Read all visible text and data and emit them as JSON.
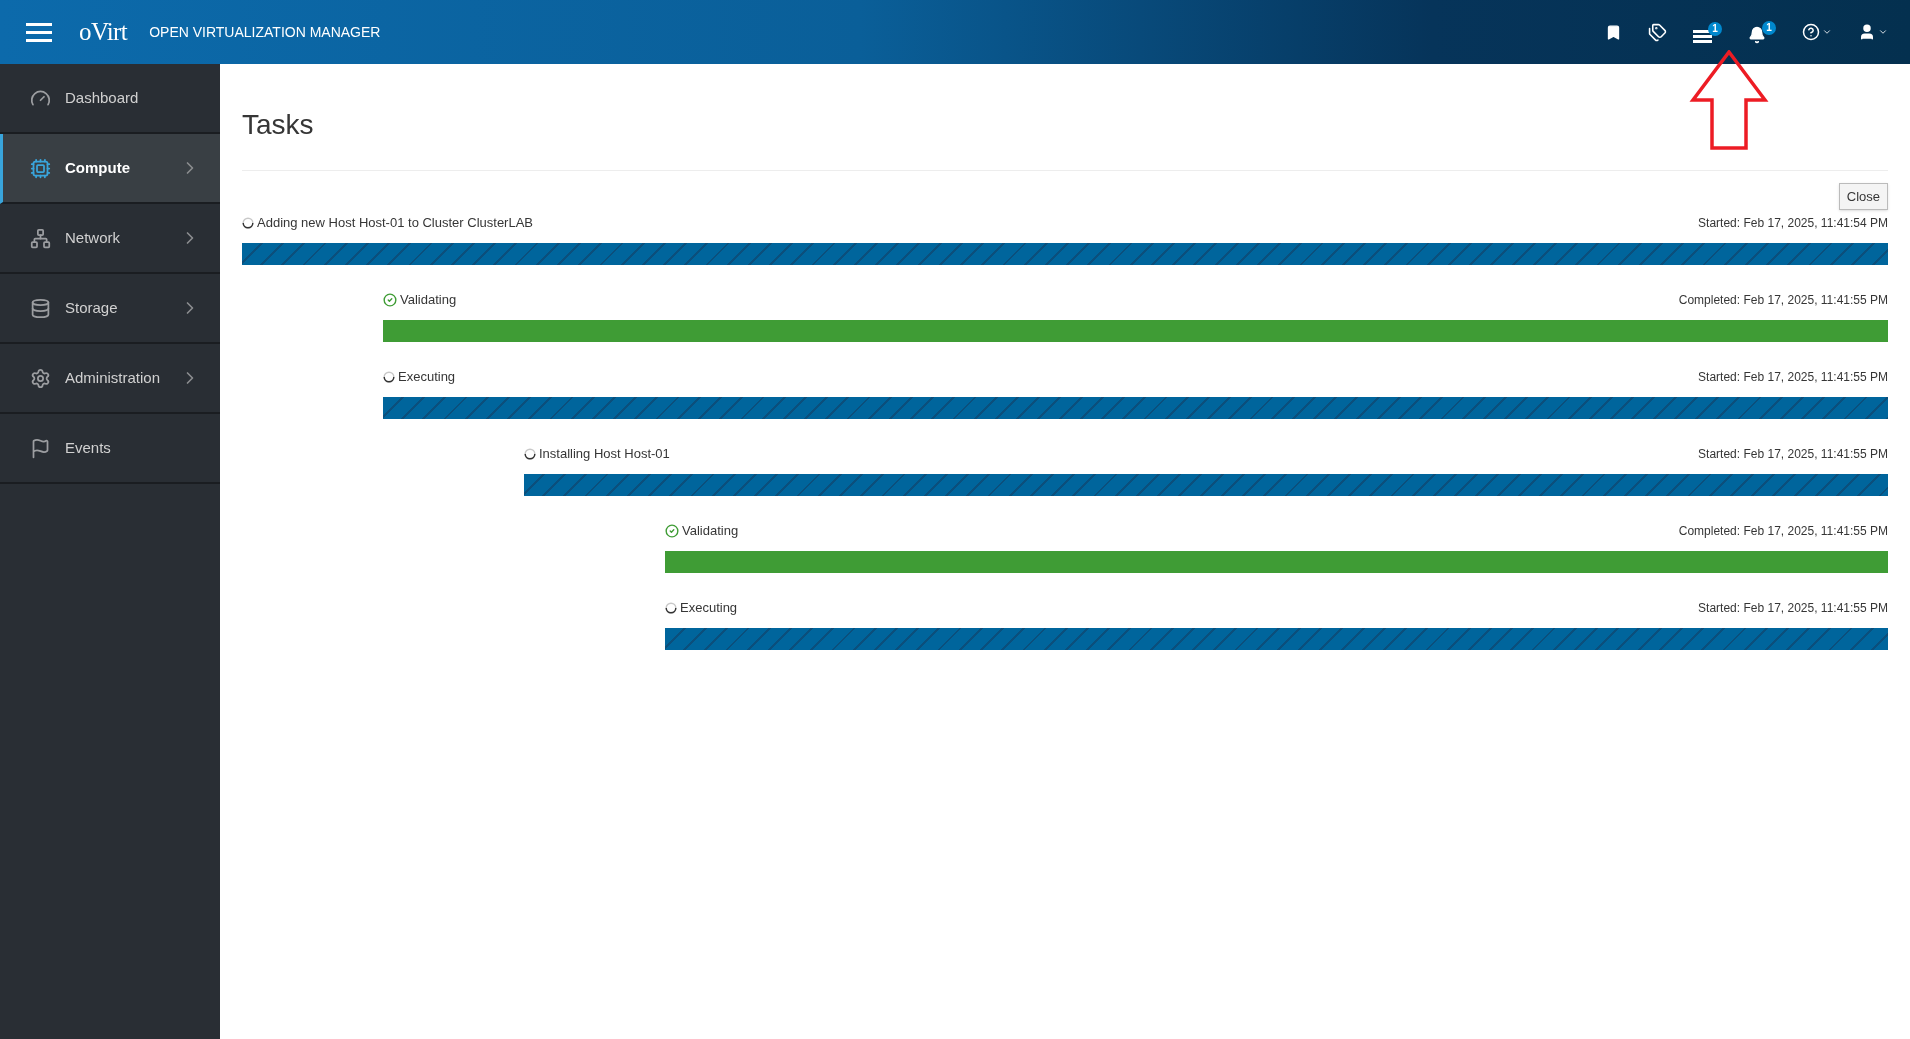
{
  "header": {
    "brand": "oVirt",
    "product": "OPEN VIRTUALIZATION MANAGER",
    "tasks_badge": "1",
    "notifications_badge": "1"
  },
  "sidebar": {
    "items": [
      {
        "kind": "dashboard",
        "label": "Dashboard",
        "selected": false,
        "expandable": false
      },
      {
        "kind": "compute",
        "label": "Compute",
        "selected": true,
        "expandable": true
      },
      {
        "kind": "network",
        "label": "Network",
        "selected": false,
        "expandable": true
      },
      {
        "kind": "storage",
        "label": "Storage",
        "selected": false,
        "expandable": true
      },
      {
        "kind": "administration",
        "label": "Administration",
        "selected": false,
        "expandable": true
      },
      {
        "kind": "events",
        "label": "Events",
        "selected": false,
        "expandable": false
      }
    ]
  },
  "main": {
    "title": "Tasks",
    "close_button": "Close",
    "tasks": [
      {
        "kind": "running",
        "label": "Adding new Host Host-01 to Cluster ClusterLAB",
        "time": "Started: Feb 17, 2025, 11:41:54 PM",
        "children": [
          {
            "kind": "completed",
            "label": "Validating",
            "time": "Completed: Feb 17, 2025, 11:41:55 PM"
          },
          {
            "kind": "running",
            "label": "Executing",
            "time": "Started: Feb 17, 2025, 11:41:55 PM",
            "children": [
              {
                "kind": "running",
                "label": "Installing Host Host-01",
                "time": "Started: Feb 17, 2025, 11:41:55 PM",
                "children": [
                  {
                    "kind": "completed",
                    "label": "Validating",
                    "time": "Completed: Feb 17, 2025, 11:41:55 PM"
                  },
                  {
                    "kind": "running",
                    "label": "Executing",
                    "time": "Started: Feb 17, 2025, 11:41:55 PM"
                  }
                ]
              }
            ]
          }
        ]
      }
    ]
  }
}
